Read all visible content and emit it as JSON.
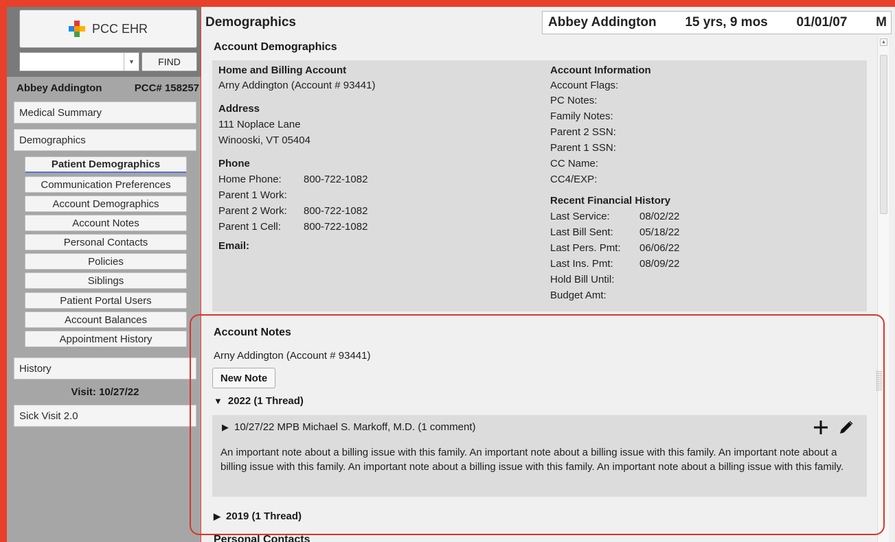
{
  "brand": {
    "name": "PCC EHR",
    "find_label": "FIND"
  },
  "sidebar": {
    "patient_name": "Abbey Addington",
    "pcc_number": "PCC# 158257",
    "medical_summary": "Medical Summary",
    "demographics": "Demographics",
    "subitems": [
      "Patient Demographics",
      "Communication Preferences",
      "Account Demographics",
      "Account Notes",
      "Personal Contacts",
      "Policies",
      "Siblings",
      "Patient Portal Users",
      "Account Balances",
      "Appointment History"
    ],
    "history": "History",
    "visit_label": "Visit: 10/27/22",
    "sick_visit": "Sick Visit 2.0"
  },
  "header": {
    "page_title": "Demographics",
    "patient_name": "Abbey Addington",
    "age": "15 yrs, 9 mos",
    "dob": "01/01/07",
    "sex": "M"
  },
  "account_demographics": {
    "title": "Account Demographics",
    "home_billing_title": "Home and Billing Account",
    "home_billing_value": "Arny Addington (Account # 93441)",
    "address_title": "Address",
    "address_line1": "111 Noplace Lane",
    "address_line2": "Winooski, VT 05404",
    "phone_title": "Phone",
    "phones": [
      {
        "label": "Home Phone:",
        "value": "800-722-1082"
      },
      {
        "label": "Parent 1 Work:",
        "value": ""
      },
      {
        "label": "Parent 2 Work:",
        "value": "800-722-1082"
      },
      {
        "label": "Parent 1 Cell:",
        "value": "800-722-1082"
      }
    ],
    "email_title": "Email:",
    "account_info_title": "Account Information",
    "account_info": [
      "Account Flags:",
      "PC Notes:",
      "Family Notes:",
      "Parent 2 SSN:",
      "Parent 1 SSN:",
      "CC Name:",
      "CC4/EXP:"
    ],
    "financial_title": "Recent Financial History",
    "financial": [
      {
        "label": "Last Service:",
        "value": "08/02/22"
      },
      {
        "label": "Last Bill Sent:",
        "value": "05/18/22"
      },
      {
        "label": "Last Pers. Pmt:",
        "value": "06/06/22"
      },
      {
        "label": "Last Ins. Pmt:",
        "value": "08/09/22"
      },
      {
        "label": "Hold Bill Until:",
        "value": ""
      },
      {
        "label": "Budget Amt:",
        "value": ""
      }
    ]
  },
  "account_notes": {
    "title": "Account Notes",
    "account": "Arny Addington (Account # 93441)",
    "new_note_label": "New Note",
    "thread_2022": "2022 (1 Thread)",
    "note_header": "10/27/22 MPB Michael S. Markoff, M.D.  (1 comment)",
    "note_body": "An important note about a billing issue with this family. An important note about a billing issue with this family. An important note about a billing issue with this family. An important note about a billing issue with this family. An important note about a billing issue with this family.",
    "thread_2019": "2019 (1 Thread)"
  },
  "personal_contacts": {
    "title": "Personal Contacts"
  },
  "colors": {
    "frame": "#e8402a",
    "sidebar": "#a6a6a6",
    "highlight": "#d9342b",
    "active_underline": "#5a6fd8"
  }
}
